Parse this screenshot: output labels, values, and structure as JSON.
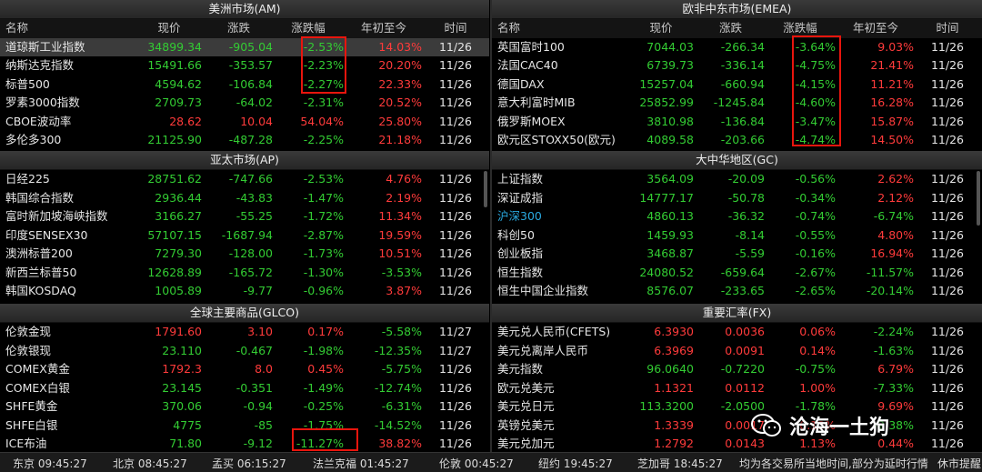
{
  "headers": {
    "name": "名称",
    "price": "现价",
    "change": "涨跌",
    "pct": "涨跌幅",
    "ytd": "年初至今",
    "time": "时间"
  },
  "panels": {
    "am": {
      "title": "美洲市场(AM)",
      "rows": [
        {
          "name": "道琼斯工业指数",
          "price": "34899.34",
          "chg": "-905.04",
          "pct": "-2.53%",
          "ytd": "14.03%",
          "time": "11/26",
          "pc": "down",
          "yc": "up"
        },
        {
          "name": "纳斯达克指数",
          "price": "15491.66",
          "chg": "-353.57",
          "pct": "-2.23%",
          "ytd": "20.20%",
          "time": "11/26",
          "pc": "down",
          "yc": "up"
        },
        {
          "name": "标普500",
          "price": "4594.62",
          "chg": "-106.84",
          "pct": "-2.27%",
          "ytd": "22.33%",
          "time": "11/26",
          "pc": "down",
          "yc": "up"
        },
        {
          "name": "罗素3000指数",
          "price": "2709.73",
          "chg": "-64.02",
          "pct": "-2.31%",
          "ytd": "20.52%",
          "time": "11/26",
          "pc": "down",
          "yc": "up"
        },
        {
          "name": "CBOE波动率",
          "price": "28.62",
          "chg": "10.04",
          "pct": "54.04%",
          "ytd": "25.80%",
          "time": "11/26",
          "pc": "up",
          "yc": "up"
        },
        {
          "name": "多伦多300",
          "price": "21125.90",
          "chg": "-487.28",
          "pct": "-2.25%",
          "ytd": "21.18%",
          "time": "11/26",
          "pc": "down",
          "yc": "up"
        }
      ]
    },
    "emea": {
      "title": "欧非中东市场(EMEA)",
      "rows": [
        {
          "name": "英国富时100",
          "price": "7044.03",
          "chg": "-266.34",
          "pct": "-3.64%",
          "ytd": "9.03%",
          "time": "11/26",
          "pc": "down",
          "yc": "up"
        },
        {
          "name": "法国CAC40",
          "price": "6739.73",
          "chg": "-336.14",
          "pct": "-4.75%",
          "ytd": "21.41%",
          "time": "11/26",
          "pc": "down",
          "yc": "up"
        },
        {
          "name": "德国DAX",
          "price": "15257.04",
          "chg": "-660.94",
          "pct": "-4.15%",
          "ytd": "11.21%",
          "time": "11/26",
          "pc": "down",
          "yc": "up"
        },
        {
          "name": "意大利富时MIB",
          "price": "25852.99",
          "chg": "-1245.84",
          "pct": "-4.60%",
          "ytd": "16.28%",
          "time": "11/26",
          "pc": "down",
          "yc": "up"
        },
        {
          "name": "俄罗斯MOEX",
          "price": "3810.98",
          "chg": "-136.84",
          "pct": "-3.47%",
          "ytd": "15.87%",
          "time": "11/26",
          "pc": "down",
          "yc": "up"
        },
        {
          "name": "欧元区STOXX50(欧元)",
          "price": "4089.58",
          "chg": "-203.66",
          "pct": "-4.74%",
          "ytd": "14.50%",
          "time": "11/26",
          "pc": "down",
          "yc": "up"
        }
      ]
    },
    "ap": {
      "title": "亚太市场(AP)",
      "rows": [
        {
          "name": "日经225",
          "price": "28751.62",
          "chg": "-747.66",
          "pct": "-2.53%",
          "ytd": "4.76%",
          "time": "11/26",
          "pc": "down",
          "yc": "up"
        },
        {
          "name": "韩国综合指数",
          "price": "2936.44",
          "chg": "-43.83",
          "pct": "-1.47%",
          "ytd": "2.19%",
          "time": "11/26",
          "pc": "down",
          "yc": "up"
        },
        {
          "name": "富时新加坡海峡指数",
          "price": "3166.27",
          "chg": "-55.25",
          "pct": "-1.72%",
          "ytd": "11.34%",
          "time": "11/26",
          "pc": "down",
          "yc": "up"
        },
        {
          "name": "印度SENSEX30",
          "price": "57107.15",
          "chg": "-1687.94",
          "pct": "-2.87%",
          "ytd": "19.59%",
          "time": "11/26",
          "pc": "down",
          "yc": "up"
        },
        {
          "name": "澳洲标普200",
          "price": "7279.30",
          "chg": "-128.00",
          "pct": "-1.73%",
          "ytd": "10.51%",
          "time": "11/26",
          "pc": "down",
          "yc": "up"
        },
        {
          "name": "新西兰标普50",
          "price": "12628.89",
          "chg": "-165.72",
          "pct": "-1.30%",
          "ytd": "-3.53%",
          "time": "11/26",
          "pc": "down",
          "yc": "down"
        },
        {
          "name": "韩国KOSDAQ",
          "price": "1005.89",
          "chg": "-9.77",
          "pct": "-0.96%",
          "ytd": "3.87%",
          "time": "11/26",
          "pc": "down",
          "yc": "up"
        }
      ]
    },
    "gc": {
      "title": "大中华地区(GC)",
      "rows": [
        {
          "name": "上证指数",
          "price": "3564.09",
          "chg": "-20.09",
          "pct": "-0.56%",
          "ytd": "2.62%",
          "time": "11/26",
          "pc": "down",
          "yc": "up"
        },
        {
          "name": "深证成指",
          "price": "14777.17",
          "chg": "-50.78",
          "pct": "-0.34%",
          "ytd": "2.12%",
          "time": "11/26",
          "pc": "down",
          "yc": "up"
        },
        {
          "name": "沪深300",
          "price": "4860.13",
          "chg": "-36.32",
          "pct": "-0.74%",
          "ytd": "-6.74%",
          "time": "11/26",
          "pc": "down",
          "yc": "down",
          "nc": "cyan"
        },
        {
          "name": "科创50",
          "price": "1459.93",
          "chg": "-8.14",
          "pct": "-0.55%",
          "ytd": "4.80%",
          "time": "11/26",
          "pc": "down",
          "yc": "up"
        },
        {
          "name": "创业板指",
          "price": "3468.87",
          "chg": "-5.59",
          "pct": "-0.16%",
          "ytd": "16.94%",
          "time": "11/26",
          "pc": "down",
          "yc": "up"
        },
        {
          "name": "恒生指数",
          "price": "24080.52",
          "chg": "-659.64",
          "pct": "-2.67%",
          "ytd": "-11.57%",
          "time": "11/26",
          "pc": "down",
          "yc": "down"
        },
        {
          "name": "恒生中国企业指数",
          "price": "8576.07",
          "chg": "-233.65",
          "pct": "-2.65%",
          "ytd": "-20.14%",
          "time": "11/26",
          "pc": "down",
          "yc": "down"
        }
      ]
    },
    "glco": {
      "title": "全球主要商品(GLCO)",
      "rows": [
        {
          "name": "伦敦金现",
          "price": "1791.60",
          "chg": "3.10",
          "pct": "0.17%",
          "ytd": "-5.58%",
          "time": "11/27",
          "pc": "up",
          "yc": "down",
          "prc": "up"
        },
        {
          "name": "伦敦银现",
          "price": "23.110",
          "chg": "-0.467",
          "pct": "-1.98%",
          "ytd": "-12.35%",
          "time": "11/27",
          "pc": "down",
          "yc": "down"
        },
        {
          "name": "COMEX黄金",
          "price": "1792.3",
          "chg": "8.0",
          "pct": "0.45%",
          "ytd": "-5.75%",
          "time": "11/26",
          "pc": "up",
          "yc": "down",
          "prc": "up"
        },
        {
          "name": "COMEX白银",
          "price": "23.145",
          "chg": "-0.351",
          "pct": "-1.49%",
          "ytd": "-12.74%",
          "time": "11/26",
          "pc": "down",
          "yc": "down"
        },
        {
          "name": "SHFE黄金",
          "price": "370.06",
          "chg": "-0.94",
          "pct": "-0.25%",
          "ytd": "-6.31%",
          "time": "11/26",
          "pc": "down",
          "yc": "down"
        },
        {
          "name": "SHFE白银",
          "price": "4775",
          "chg": "-85",
          "pct": "-1.75%",
          "ytd": "-14.52%",
          "time": "11/26",
          "pc": "down",
          "yc": "down"
        },
        {
          "name": "ICE布油",
          "price": "71.80",
          "chg": "-9.12",
          "pct": "-11.27%",
          "ytd": "38.82%",
          "time": "11/26",
          "pc": "down",
          "yc": "up"
        }
      ]
    },
    "fx": {
      "title": "重要汇率(FX)",
      "rows": [
        {
          "name": "美元兑人民币(CFETS)",
          "price": "6.3930",
          "chg": "0.0036",
          "pct": "0.06%",
          "ytd": "-2.24%",
          "time": "11/26",
          "pc": "up",
          "yc": "down",
          "prc": "up"
        },
        {
          "name": "美元兑离岸人民币",
          "price": "6.3969",
          "chg": "0.0091",
          "pct": "0.14%",
          "ytd": "-1.63%",
          "time": "11/26",
          "pc": "up",
          "yc": "down",
          "prc": "up"
        },
        {
          "name": "美元指数",
          "price": "96.0640",
          "chg": "-0.7220",
          "pct": "-0.75%",
          "ytd": "6.79%",
          "time": "11/26",
          "pc": "down",
          "yc": "up"
        },
        {
          "name": "欧元兑美元",
          "price": "1.1321",
          "chg": "0.0112",
          "pct": "1.00%",
          "ytd": "-7.33%",
          "time": "11/26",
          "pc": "up",
          "yc": "down",
          "prc": "up"
        },
        {
          "name": "美元兑日元",
          "price": "113.3200",
          "chg": "-2.0500",
          "pct": "-1.78%",
          "ytd": "9.69%",
          "time": "11/26",
          "pc": "down",
          "yc": "up"
        },
        {
          "name": "英镑兑美元",
          "price": "1.3339",
          "chg": "0.0017",
          "pct": "0.13%",
          "ytd": "-2.38%",
          "time": "11/26",
          "pc": "up",
          "yc": "down",
          "prc": "up"
        },
        {
          "name": "美元兑加元",
          "price": "1.2792",
          "chg": "0.0143",
          "pct": "1.13%",
          "ytd": "0.44%",
          "time": "11/26",
          "pc": "up",
          "yc": "up",
          "prc": "up"
        }
      ]
    }
  },
  "status": [
    "东京 09:45:27",
    "北京 08:45:27",
    "孟买 06:15:27",
    "法兰克福 01:45:27",
    "伦敦 00:45:27",
    "纽约 19:45:27",
    "芝加哥 18:45:27",
    "均为各交易所当地时间,部分为延时行情",
    "休市提醒"
  ],
  "watermark": "沧海一土狗",
  "colors": {
    "up": "#ff3b3b",
    "down": "#33cc33",
    "highlight_box": "#e8150d"
  }
}
